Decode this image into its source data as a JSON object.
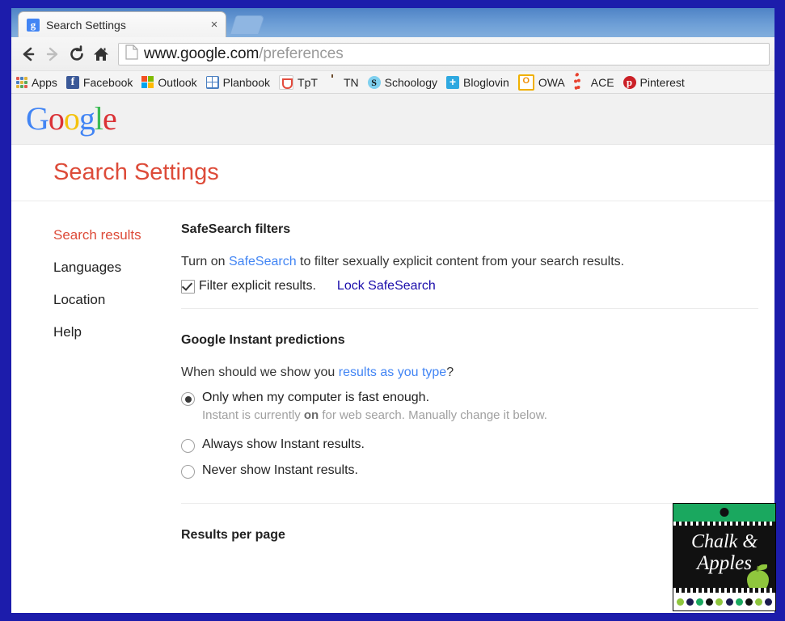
{
  "frame": {
    "border_color": "#1c1cab"
  },
  "browser": {
    "tab": {
      "title": "Search Settings",
      "favicon": "google-favicon",
      "favicon_letter": "g",
      "close_label": "×"
    },
    "newtab_label": "",
    "toolbar": {
      "back_icon": "back-arrow-icon",
      "forward_icon": "forward-arrow-icon",
      "reload_icon": "reload-icon",
      "home_icon": "home-icon",
      "page_icon": "page-document-icon",
      "url_host": "www.google.com",
      "url_path": "/preferences"
    },
    "bookmarks": [
      {
        "label": "Apps",
        "icon": "apps-grid-icon"
      },
      {
        "label": "Facebook",
        "icon": "facebook-icon"
      },
      {
        "label": "Outlook",
        "icon": "outlook-icon"
      },
      {
        "label": "Planbook",
        "icon": "planbook-icon"
      },
      {
        "label": "TpT",
        "icon": "tpt-icon"
      },
      {
        "label": "TN",
        "icon": "apple-icon"
      },
      {
        "label": "Schoology",
        "icon": "schoology-icon"
      },
      {
        "label": "Bloglovin",
        "icon": "bloglovin-icon"
      },
      {
        "label": "OWA",
        "icon": "owa-icon"
      },
      {
        "label": "ACE",
        "icon": "ace-icon"
      },
      {
        "label": "Pinterest",
        "icon": "pinterest-icon"
      }
    ]
  },
  "page": {
    "logo": {
      "letters": [
        "G",
        "o",
        "o",
        "g",
        "l",
        "e"
      ]
    },
    "title": "Search Settings",
    "nav": [
      {
        "label": "Search results",
        "active": true
      },
      {
        "label": "Languages",
        "active": false
      },
      {
        "label": "Location",
        "active": false
      },
      {
        "label": "Help",
        "active": false
      }
    ],
    "sections": {
      "safesearch": {
        "heading": "SafeSearch filters",
        "para_before": "Turn on ",
        "para_link": "SafeSearch",
        "para_after": " to filter sexually explicit content from your search results.",
        "checkbox_label": "Filter explicit results.",
        "checkbox_checked": true,
        "lock_link": "Lock SafeSearch"
      },
      "instant": {
        "heading": "Google Instant predictions",
        "question_before": "When should we show you ",
        "question_link": "results as you type",
        "question_after": "?",
        "options": [
          {
            "label": "Only when my computer is fast enough.",
            "selected": true,
            "sub_before": "Instant is currently ",
            "sub_strong": "on",
            "sub_after": " for web search. Manually change it below."
          },
          {
            "label": "Always show Instant results.",
            "selected": false
          },
          {
            "label": "Never show Instant results.",
            "selected": false
          }
        ]
      },
      "results_per_page": {
        "heading": "Results per page"
      }
    },
    "colors": {
      "accent_red": "#dd4b39",
      "link_blue": "#1a0dab",
      "google_blue": "#4285f4"
    }
  },
  "watermark": {
    "line1": "Chalk &",
    "line2": "Apples",
    "top_color": "#1aa85f",
    "board_color": "#111111"
  }
}
